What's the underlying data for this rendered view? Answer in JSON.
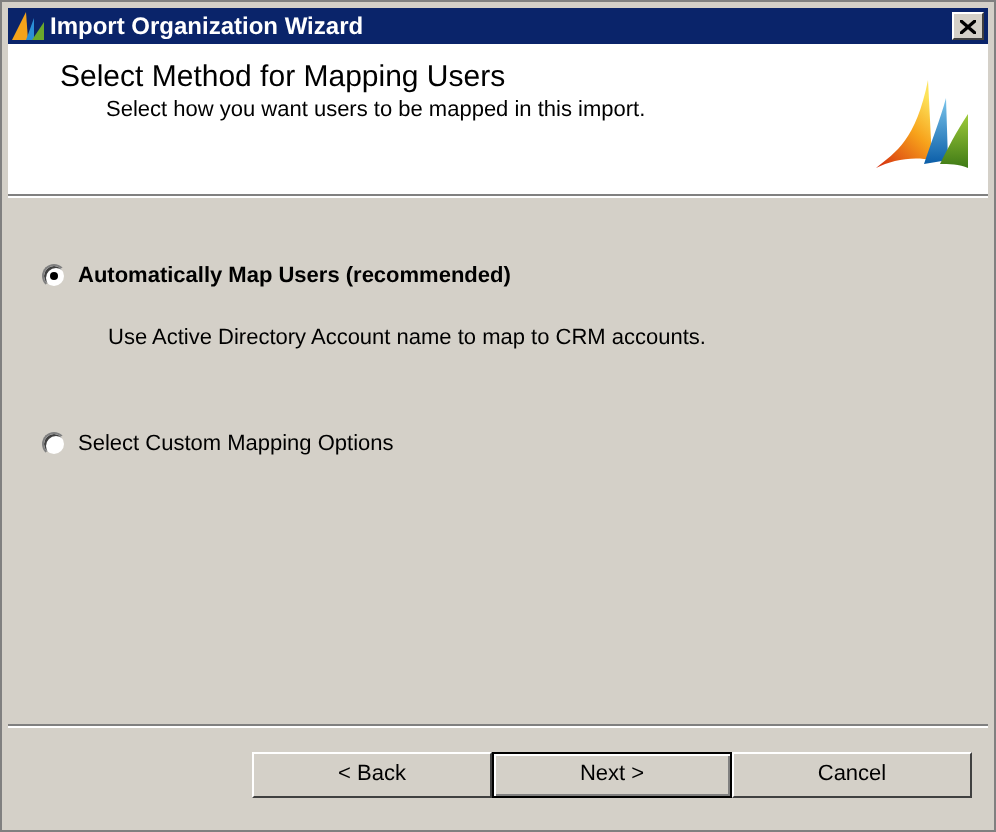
{
  "window": {
    "title": "Import Organization Wizard"
  },
  "header": {
    "title": "Select Method for Mapping Users",
    "subtitle": "Select how you want users to be mapped in this import."
  },
  "options": [
    {
      "label": "Automatically Map Users (recommended)",
      "selected": true,
      "description": "Use Active Directory Account name to map to CRM accounts."
    },
    {
      "label": "Select Custom Mapping Options",
      "selected": false
    }
  ],
  "buttons": [
    {
      "label": "< Back",
      "default": false
    },
    {
      "label": "Next >",
      "default": true
    },
    {
      "label": "Cancel",
      "default": false
    }
  ]
}
